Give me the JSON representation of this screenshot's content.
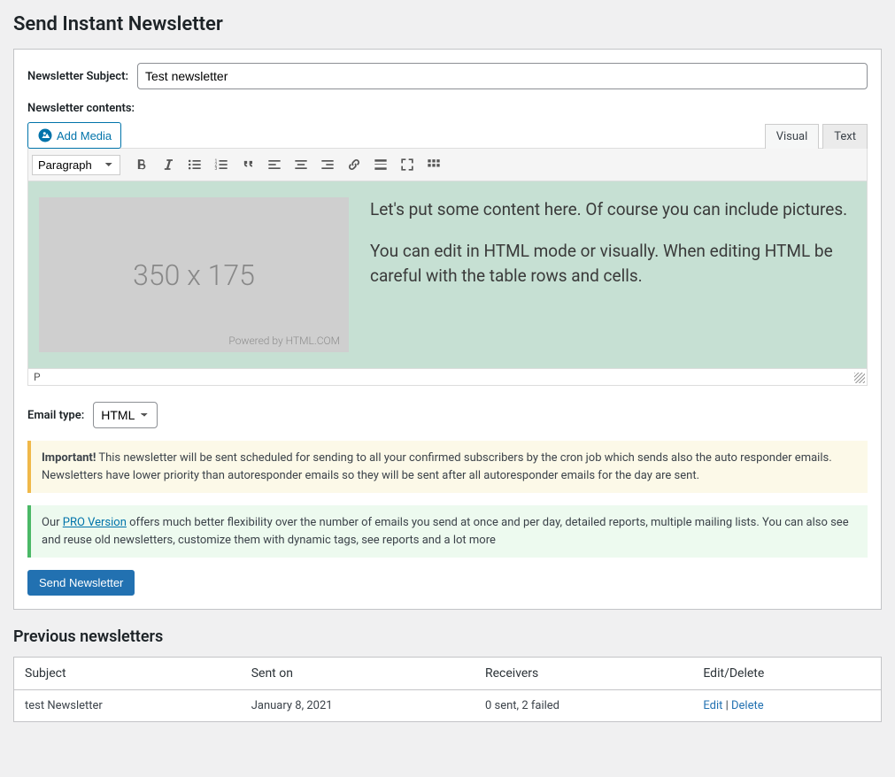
{
  "page_title": "Send Instant Newsletter",
  "subject": {
    "label": "Newsletter Subject:",
    "value": "Test newsletter"
  },
  "contents_label": "Newsletter contents:",
  "media_button": "Add Media",
  "tabs": {
    "visual": "Visual",
    "text": "Text"
  },
  "format_select": "Paragraph",
  "placeholder_image": {
    "dimensions": "350 x 175",
    "powered": "Powered by HTML.COM"
  },
  "editor_paragraphs": {
    "p1": "Let's put some content here.  Of course you can include pictures.",
    "p2": "You can edit in HTML mode or visually. When editing HTML be careful with the table rows and cells."
  },
  "status_path": "P",
  "email_type": {
    "label": "Email type:",
    "value": "HTML"
  },
  "warning": {
    "strong": "Important!",
    "text": " This newsletter will be sent scheduled for sending to all your confirmed subscribers by the cron job which sends also the auto responder emails. Newsletters have lower priority than autoresponder emails so they will be sent after all autoresponder emails for the day are sent."
  },
  "info": {
    "pre": "Our ",
    "link": "PRO Version",
    "post": " offers much better flexibility over the number of emails you send at once and per day, detailed reports, multiple mailing lists. You can also see and reuse old newsletters, customize them with dynamic tags, see reports and a lot more"
  },
  "send_button": "Send Newsletter",
  "previous": {
    "heading": "Previous newsletters",
    "headers": {
      "subject": "Subject",
      "sent_on": "Sent on",
      "receivers": "Receivers",
      "actions": "Edit/Delete"
    },
    "rows": [
      {
        "subject": "test Newsletter",
        "sent_on": "January 8, 2021",
        "receivers": "0 sent, 2 failed",
        "edit": "Edit",
        "delete": "Delete"
      }
    ]
  }
}
